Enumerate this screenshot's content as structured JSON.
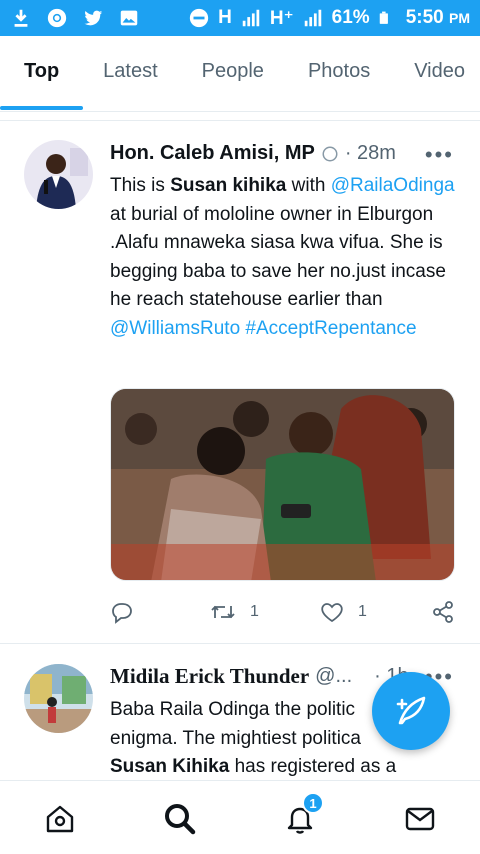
{
  "status_bar": {
    "network_1": "H",
    "network_2": "H⁺",
    "battery": "61%",
    "time": "5:50",
    "ampm": "PM"
  },
  "tabs": [
    "Top",
    "Latest",
    "People",
    "Photos",
    "Video"
  ],
  "tweets": [
    {
      "author": "Hon. Caleb Amisi, MP",
      "handle_fragment": "@",
      "time": "· 28m",
      "text_parts": [
        "This is ",
        "Susan kihika",
        " with ",
        "@RailaOdinga",
        " at burial of mololine owner in Elburgon .Alafu mnaweka siasa kwa vifua. She is begging baba to save her no.just incase he reach statehouse earlier than ",
        "@WilliamsRuto",
        " ",
        "#AcceptRepentance"
      ],
      "reply_count": "",
      "retweet_count": "1",
      "like_count": "1"
    },
    {
      "author": "Midila Erick Thunder",
      "handle_fragment": "@...",
      "time": "· 1h",
      "text_parts": [
        "Baba Raila Odinga the politic",
        "enigma. The mightiest politica",
        "Susan Kihika",
        " has registered as a"
      ]
    }
  ],
  "more_label": "•••",
  "notifications_badge": "1",
  "colors": {
    "accent": "#1da1f2",
    "text": "#0f1419",
    "muted": "#536471"
  },
  "icons": [
    "download-icon",
    "chrome-icon",
    "twitter-icon",
    "image-icon",
    "dnd-icon",
    "signal-icon",
    "battery-icon",
    "home-icon",
    "search-icon",
    "notifications-icon",
    "messages-icon",
    "compose-icon",
    "reply-icon",
    "retweet-icon",
    "like-icon",
    "share-icon",
    "verified-icon"
  ]
}
